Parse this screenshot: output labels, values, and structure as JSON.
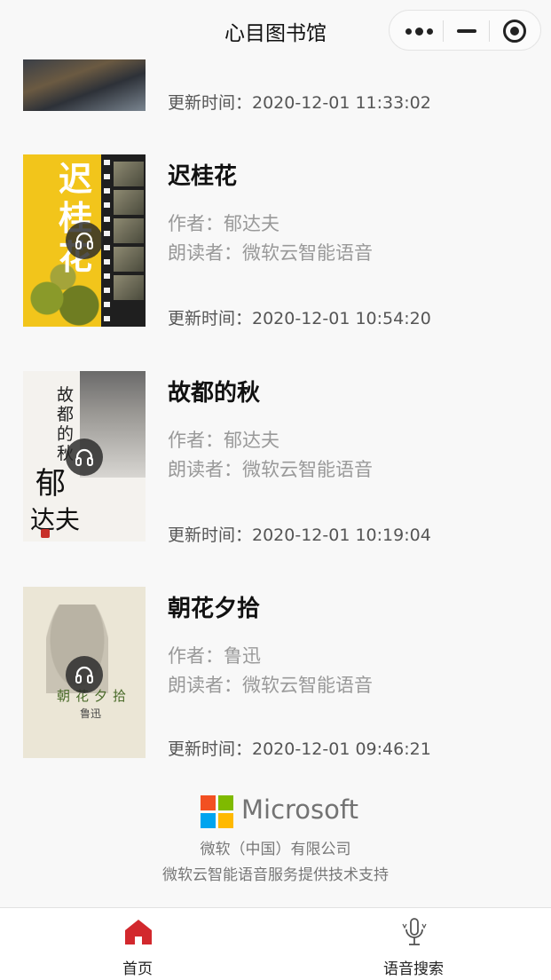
{
  "header": {
    "title": "心目图书馆"
  },
  "capsule": {
    "more_icon": "more-dots-icon",
    "minimize_icon": "minimize-icon",
    "close_icon": "target-circle-icon"
  },
  "books": [
    {
      "updated": "更新时间：2020-12-01 11:33:02"
    },
    {
      "title": "迟桂花",
      "author": "作者：郁达夫",
      "narrator": "朗读者：微软云智能语音",
      "updated": "更新时间：2020-12-01 10:54:20",
      "cover_text": "迟桂花"
    },
    {
      "title": "故都的秋",
      "author": "作者：郁达夫",
      "narrator": "朗读者：微软云智能语音",
      "updated": "更新时间：2020-12-01 10:19:04",
      "cover_title": "故都的秋",
      "cover_author": "郁",
      "cover_author2": "达夫"
    },
    {
      "title": "朝花夕拾",
      "author": "作者：鲁迅",
      "narrator": "朗读者：微软云智能语音",
      "updated": "更新时间：2020-12-01 09:46:21",
      "cover_title": "朝花夕拾",
      "cover_sig": "鲁迅"
    }
  ],
  "footer": {
    "brand": "Microsoft",
    "company": "微软（中国）有限公司",
    "support": "微软云智能语音服务提供技术支持",
    "logo_colors": [
      "#f25022",
      "#7fba00",
      "#00a4ef",
      "#ffb900"
    ]
  },
  "tabbar": {
    "home_label": "首页",
    "voice_label": "语音搜索",
    "active_color": "#d2282d",
    "inactive_color": "#555555"
  }
}
